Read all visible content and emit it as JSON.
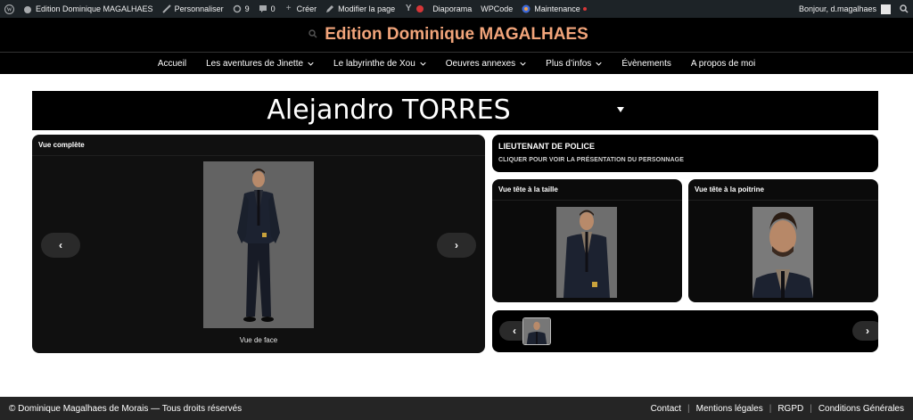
{
  "adminbar": {
    "site_name": "Edition Dominique MAGALHAES",
    "customize": "Personnaliser",
    "updates_count": "9",
    "comments_count": "0",
    "new": "Créer",
    "edit_page": "Modifier la page",
    "slideshow": "Diaporama",
    "wpcode": "WPCode",
    "maintenance": "Maintenance",
    "greeting": "Bonjour, d.magalhaes",
    "alert_color": "#d63638"
  },
  "header": {
    "title": "Edition Dominique MAGALHAES",
    "title_color": "#f1a47a"
  },
  "nav": {
    "items": [
      {
        "label": "Accueil",
        "dropdown": false
      },
      {
        "label": "Les aventures de Jinette",
        "dropdown": true
      },
      {
        "label": "Le labyrinthe de Xou",
        "dropdown": true
      },
      {
        "label": "Oeuvres annexes",
        "dropdown": true
      },
      {
        "label": "Plus d’infos",
        "dropdown": true
      },
      {
        "label": "Évènements",
        "dropdown": false
      },
      {
        "label": "A propos de moi",
        "dropdown": false
      }
    ]
  },
  "character": {
    "name": "Alejandro TORRES",
    "main_panel_title": "Vue complète",
    "main_caption": "Vue de face",
    "prev": "‹",
    "next": "›",
    "role": "LIEUTENANT DE POLICE",
    "role_link": "CLIQUER POUR VOIR LA PRÉSENTATION DU PERSONNAGE",
    "view_waist": "Vue tête à la taille",
    "view_chest": "Vue tête à la poitrine"
  },
  "footer": {
    "copyright": "© Dominique Magalhaes de Morais — Tous droits réservés",
    "links": [
      "Contact",
      "Mentions légales",
      "RGPD",
      "Conditions Générales"
    ]
  }
}
